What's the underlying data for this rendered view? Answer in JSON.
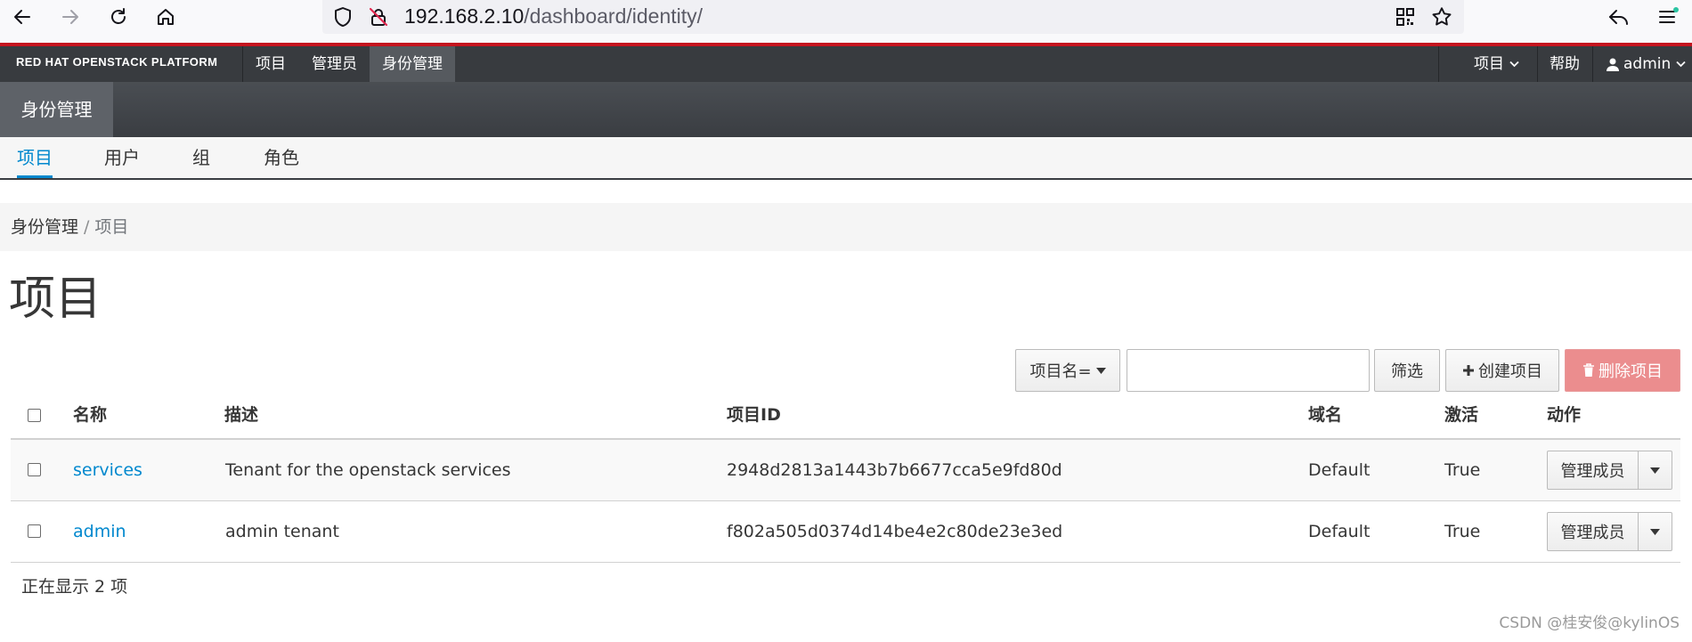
{
  "browser": {
    "url_host": "192.168.2.10",
    "url_path": "/dashboard/identity/"
  },
  "topnav": {
    "brand": "RED HAT OPENSTACK PLATFORM",
    "items": [
      "项目",
      "管理员",
      "身份管理"
    ],
    "active_item": "身份管理",
    "right_project": "项目",
    "right_help": "帮助",
    "right_user": "admin"
  },
  "subheader": {
    "active_panel": "身份管理"
  },
  "tabs": [
    "项目",
    "用户",
    "组",
    "角色"
  ],
  "active_tab": "项目",
  "breadcrumb": {
    "root": "身份管理",
    "separator": "/",
    "current": "项目"
  },
  "page": {
    "title": "项目"
  },
  "toolbar": {
    "filter_field": "项目名=",
    "filter_value": "",
    "filter_button": "筛选",
    "create_button": "创建项目",
    "delete_button": "删除项目"
  },
  "table": {
    "columns": [
      "名称",
      "描述",
      "项目ID",
      "域名",
      "激活",
      "动作"
    ],
    "rows": [
      {
        "name": "services",
        "description": "Tenant for the openstack services",
        "project_id": "2948d2813a1443b7b6677cca5e9fd80d",
        "domain": "Default",
        "enabled": "True",
        "action": "管理成员"
      },
      {
        "name": "admin",
        "description": "admin tenant",
        "project_id": "f802a505d0374d14be4e2c80de23e3ed",
        "domain": "Default",
        "enabled": "True",
        "action": "管理成员"
      }
    ],
    "footer": "正在显示 2 项"
  },
  "watermark": "CSDN @桂安俊@kylinOS",
  "colors": {
    "accent": "#0088ce",
    "danger": "#eb8d8e",
    "nav_bg": "#383b3f",
    "brand_red": "#c4141e"
  },
  "icons": [
    "back-arrow-icon",
    "forward-arrow-icon",
    "reload-icon",
    "home-icon",
    "shield-icon",
    "insecure-lock-icon",
    "qr-code-icon",
    "bookmark-star-icon",
    "share-back-icon",
    "menu-icon",
    "user-icon",
    "plus-icon",
    "trash-icon",
    "caret-down-icon"
  ]
}
